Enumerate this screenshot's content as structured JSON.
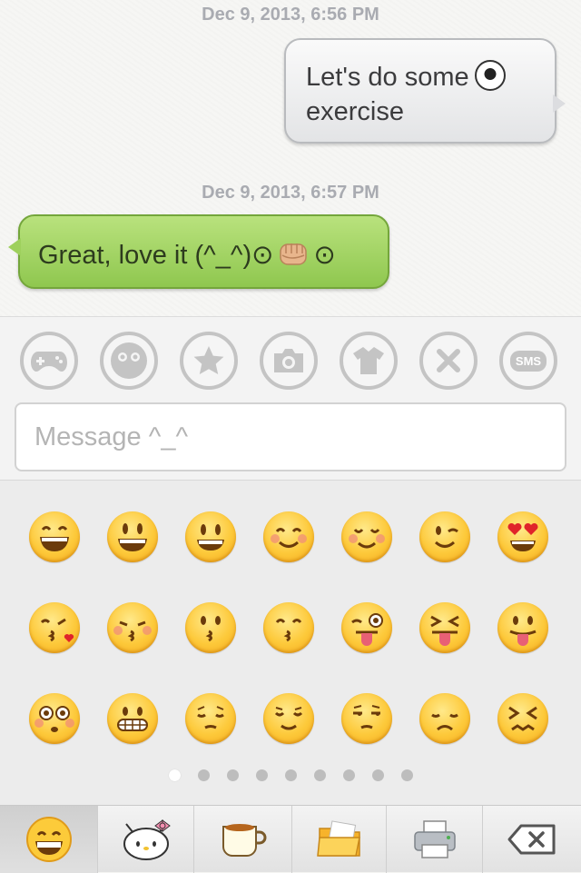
{
  "conversation": {
    "messages": [
      {
        "timestamp": "Dec 9, 2013, 6:56 PM",
        "direction": "outgoing",
        "text_line1": "Let's do some",
        "text_line2": "exercise",
        "emoji_icon": "soccer-ball-icon"
      },
      {
        "timestamp": "Dec 9, 2013, 6:57 PM",
        "direction": "incoming",
        "text_prefix": "Great, love it (^_^)",
        "text_suffix_left": "⊙",
        "text_suffix_right": "⊙",
        "emoji_icon": "raised-fist-icon"
      }
    ]
  },
  "toolbar": {
    "buttons": [
      "game-controller-icon",
      "face-icon",
      "star-icon",
      "camera-icon",
      "shirt-icon",
      "close-icon",
      "sms-icon"
    ],
    "sms_label": "SMS"
  },
  "composer": {
    "placeholder": "Message ^_^"
  },
  "emoji_keyboard": {
    "rows": [
      [
        "grinning-face-icon",
        "smiling-face-open-mouth-icon",
        "smiley-face-icon",
        "blushing-face-icon",
        "relaxed-face-icon",
        "winking-face-icon",
        "heart-eyes-face-icon"
      ],
      [
        "face-blowing-kiss-icon",
        "kissing-closed-eyes-icon",
        "kissing-face-icon",
        "kissing-smiling-eyes-icon",
        "winking-tongue-face-icon",
        "squinting-tongue-face-icon",
        "tongue-face-icon"
      ],
      [
        "flushed-face-icon",
        "grimacing-face-icon",
        "pensive-face-icon",
        "relieved-face-icon",
        "unamused-face-icon",
        "disappointed-face-icon",
        "confounded-face-icon"
      ]
    ],
    "page_count": 9,
    "current_page": 1
  },
  "tabbar": {
    "tabs": [
      "smiley-tab-icon",
      "hello-kitty-icon",
      "coffee-cup-icon",
      "folder-icon",
      "printer-icon",
      "backspace-icon"
    ],
    "active_index": 0
  },
  "colors": {
    "incoming_bubble": "#9fd15d",
    "outgoing_bubble": "#e9eaec",
    "timestamp": "#a9abb1"
  }
}
